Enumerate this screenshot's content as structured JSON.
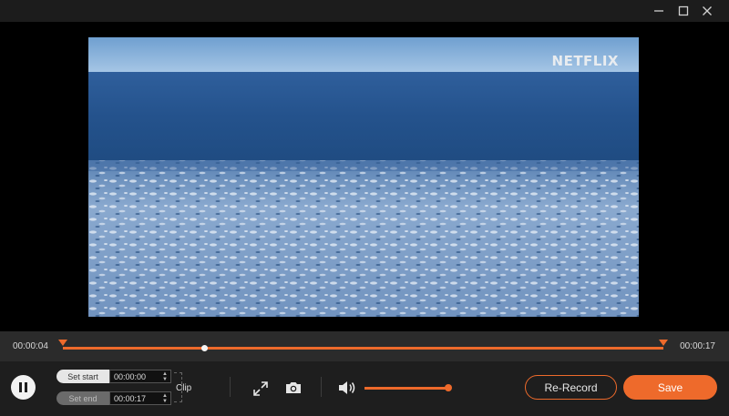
{
  "window": {
    "controls": [
      "minimize-icon",
      "maximize-icon",
      "close-icon"
    ]
  },
  "video": {
    "watermark": "NETFLIX"
  },
  "timeline": {
    "current_time": "00:00:04",
    "end_time": "00:00:17",
    "playhead_fraction": 0.23,
    "accent_color": "#ee6a2b"
  },
  "controls": {
    "set_start_label": "Set start",
    "set_start_value": "00:00:00",
    "set_end_label": "Set end",
    "set_end_value": "00:00:17",
    "clip_label": "Clip",
    "volume_fraction": 1.0,
    "rerecord_label": "Re-Record",
    "save_label": "Save"
  },
  "icons": {
    "pause": "pause-icon",
    "expand": "expand-icon",
    "screenshot": "camera-icon",
    "volume": "volume-icon"
  }
}
